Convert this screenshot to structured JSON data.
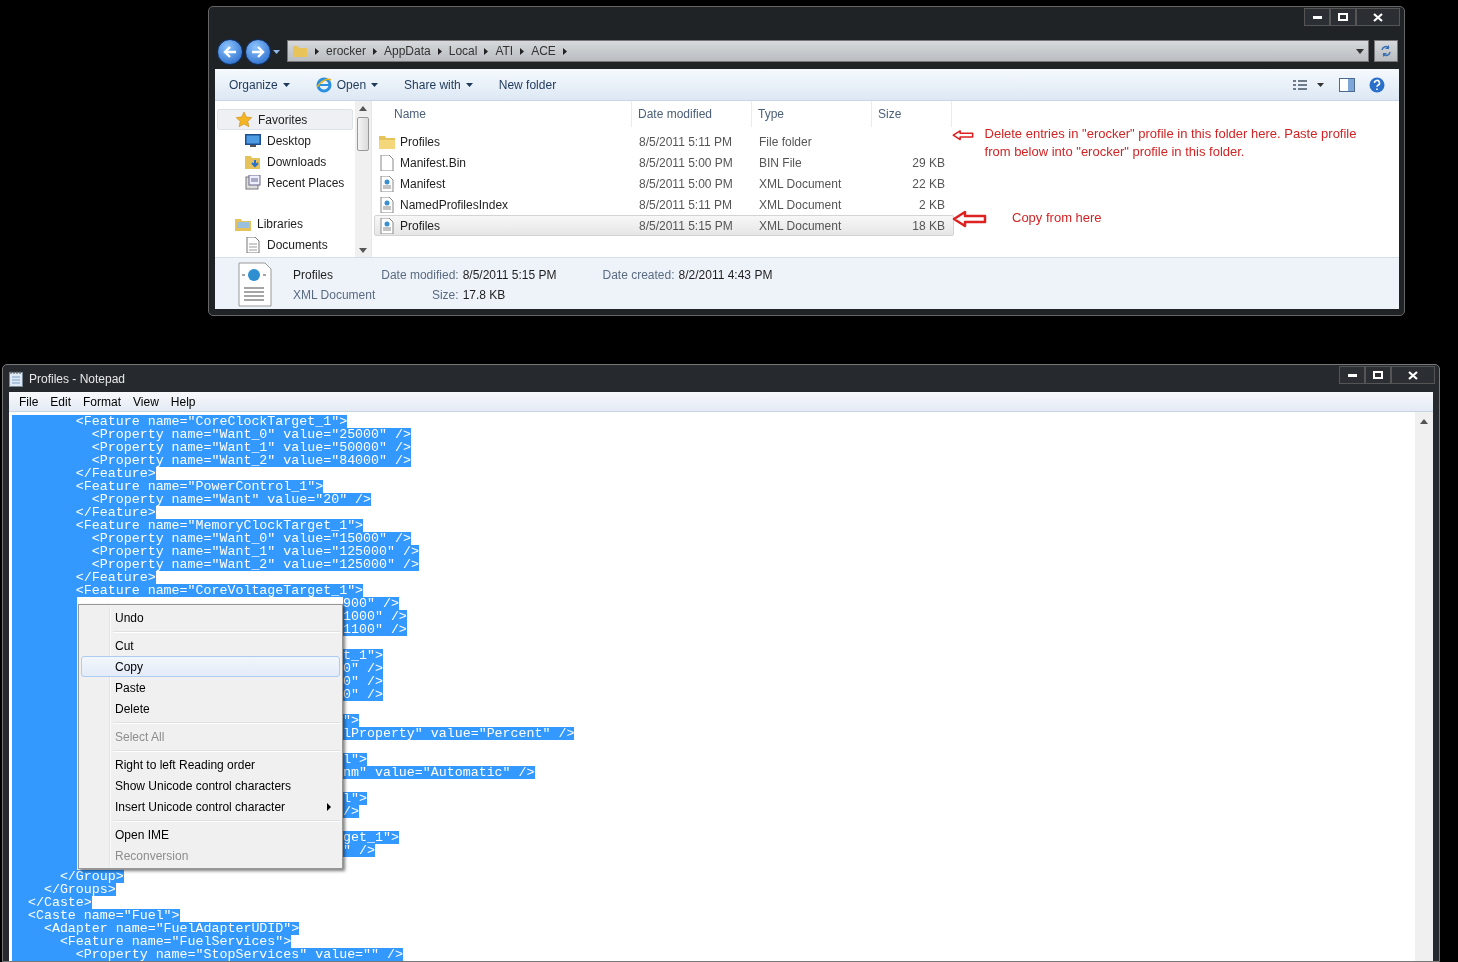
{
  "explorer": {
    "breadcrumb": [
      "erocker",
      "AppData",
      "Local",
      "ATI",
      "ACE"
    ],
    "toolbar": [
      {
        "label": "Organize",
        "kind": "dropdown"
      },
      {
        "label": "Open",
        "kind": "app-dropdown"
      },
      {
        "label": "Share with",
        "kind": "dropdown"
      },
      {
        "label": "New folder",
        "kind": "plain"
      }
    ],
    "nav": [
      {
        "label": "Favorites",
        "kind": "star",
        "hovered": true,
        "children": [
          {
            "label": "Desktop",
            "kind": "desktop",
            "hovered": false
          },
          {
            "label": "Downloads",
            "kind": "downloads",
            "hovered": false
          },
          {
            "label": "Recent Places",
            "kind": "recent",
            "hovered": false
          }
        ]
      },
      {
        "label": "Libraries",
        "kind": "library",
        "hovered": false,
        "children": [
          {
            "label": "Documents",
            "kind": "document",
            "hovered": false
          }
        ]
      }
    ],
    "columns": [
      "Name",
      "Date modified",
      "Type",
      "Size"
    ],
    "files": [
      {
        "name": "Profiles",
        "date": "8/5/2011 5:11 PM",
        "type": "File folder",
        "kind": "folder",
        "hovered": false
      },
      {
        "name": "Manifest.Bin",
        "date": "8/5/2011 5:00 PM",
        "type": "BIN File",
        "size": "29 KB",
        "kind": "file",
        "hovered": false
      },
      {
        "name": "Manifest",
        "date": "8/5/2011 5:00 PM",
        "type": "XML Document",
        "size": "22 KB",
        "kind": "xml",
        "hovered": false
      },
      {
        "name": "NamedProfilesIndex",
        "date": "8/5/2011 5:11 PM",
        "type": "XML Document",
        "size": "2 KB",
        "kind": "xml",
        "hovered": false
      },
      {
        "name": "Profiles",
        "date": "8/5/2011 5:15 PM",
        "type": "XML Document",
        "size": "18 KB",
        "kind": "xml",
        "hovered": true
      }
    ],
    "details": {
      "name": "Profiles",
      "type": "XML Document",
      "fields": [
        {
          "label": "Date modified:",
          "value": "8/5/2011 5:15 PM"
        },
        {
          "label": "Size:",
          "value": "17.8 KB"
        },
        {
          "label": "Date created:",
          "value": "8/2/2011 4:43 PM"
        }
      ]
    },
    "annotations": [
      "Delete entries in \"erocker\" profile in this folder here. Paste profile from below into \"erocker\" profile in this folder.",
      "Copy from here"
    ]
  },
  "notepad": {
    "title": "Profiles - Notepad",
    "menu": [
      "File",
      "Edit",
      "Format",
      "View",
      "Help"
    ],
    "lines": [
      {
        "kind": "full",
        "text": "        <Feature name=\"CoreClockTarget_1\">"
      },
      {
        "kind": "full",
        "text": "          <Property name=\"Want_0\" value=\"25000\" />"
      },
      {
        "kind": "full",
        "text": "          <Property name=\"Want_1\" value=\"50000\" />"
      },
      {
        "kind": "full",
        "text": "          <Property name=\"Want_2\" value=\"84000\" />"
      },
      {
        "kind": "full",
        "text": "        </Feature>"
      },
      {
        "kind": "full",
        "text": "        <Feature name=\"PowerControl_1\">"
      },
      {
        "kind": "full",
        "text": "          <Property name=\"Want\" value=\"20\" />"
      },
      {
        "kind": "full",
        "text": "        </Feature>"
      },
      {
        "kind": "full",
        "text": "        <Feature name=\"MemoryClockTarget_1\">"
      },
      {
        "kind": "full",
        "text": "          <Property name=\"Want_0\" value=\"15000\" />"
      },
      {
        "kind": "full",
        "text": "          <Property name=\"Want_1\" value=\"125000\" />"
      },
      {
        "kind": "full",
        "text": "          <Property name=\"Want_2\" value=\"125000\" />"
      },
      {
        "kind": "full",
        "text": "        </Feature>"
      },
      {
        "kind": "full",
        "text": "        <Feature name=\"CoreVoltageTarget_1\">"
      },
      {
        "kind": "tail",
        "text": "900\" />"
      },
      {
        "kind": "tail",
        "text": "1000\" />"
      },
      {
        "kind": "tail",
        "text": "1100\" />"
      },
      {
        "kind": "covered"
      },
      {
        "kind": "tail",
        "text": "t_1\">"
      },
      {
        "kind": "tail",
        "text": "0\" />"
      },
      {
        "kind": "tail",
        "text": "0\" />"
      },
      {
        "kind": "tail",
        "text": "0\" />"
      },
      {
        "kind": "covered"
      },
      {
        "kind": "tail",
        "text": "\">"
      },
      {
        "kind": "tail",
        "text": "lProperty\" value=\"Percent\" />"
      },
      {
        "kind": "covered"
      },
      {
        "kind": "tail",
        "text": "l\">"
      },
      {
        "kind": "tail",
        "text": "nm\" value=\"Automatic\" />"
      },
      {
        "kind": "covered"
      },
      {
        "kind": "tail",
        "text": "l\">"
      },
      {
        "kind": "tail",
        "text": "/>"
      },
      {
        "kind": "covered"
      },
      {
        "kind": "tail",
        "text": "get_1\">"
      },
      {
        "kind": "tail",
        "text": "\" />"
      },
      {
        "kind": "covered"
      },
      {
        "kind": "full",
        "text": "      </Group>"
      },
      {
        "kind": "full",
        "text": "    </Groups>"
      },
      {
        "kind": "full",
        "text": "  </Caste>"
      },
      {
        "kind": "full",
        "text": "  <Caste name=\"Fuel\">"
      },
      {
        "kind": "full",
        "text": "    <Adapter name=\"FuelAdapterUDID\">"
      },
      {
        "kind": "full",
        "text": "      <Feature name=\"FuelServices\">"
      },
      {
        "kind": "full",
        "text": "        <Property name=\"StopServices\" value=\"\" />"
      }
    ]
  },
  "context_menu": {
    "items": [
      {
        "kind": "item",
        "label": "Undo",
        "disabled": false,
        "selected": false,
        "submenu": false
      },
      {
        "kind": "separator"
      },
      {
        "kind": "item",
        "label": "Cut",
        "disabled": false,
        "selected": false,
        "submenu": false
      },
      {
        "kind": "item",
        "label": "Copy",
        "disabled": false,
        "selected": true,
        "submenu": false
      },
      {
        "kind": "item",
        "label": "Paste",
        "disabled": false,
        "selected": false,
        "submenu": false
      },
      {
        "kind": "item",
        "label": "Delete",
        "disabled": false,
        "selected": false,
        "submenu": false
      },
      {
        "kind": "separator"
      },
      {
        "kind": "item",
        "label": "Select All",
        "disabled": true,
        "selected": false,
        "submenu": false
      },
      {
        "kind": "separator"
      },
      {
        "kind": "item",
        "label": "Right to left Reading order",
        "disabled": false,
        "selected": false,
        "submenu": false
      },
      {
        "kind": "item",
        "label": "Show Unicode control characters",
        "disabled": false,
        "selected": false,
        "submenu": false
      },
      {
        "kind": "item",
        "label": "Insert Unicode control character",
        "disabled": false,
        "selected": false,
        "submenu": true
      },
      {
        "kind": "separator"
      },
      {
        "kind": "item",
        "label": "Open IME",
        "disabled": false,
        "selected": false,
        "submenu": false
      },
      {
        "kind": "item",
        "label": "Reconversion",
        "disabled": true,
        "selected": false,
        "submenu": false
      }
    ]
  }
}
